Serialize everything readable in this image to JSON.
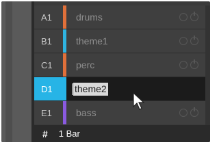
{
  "patterns": [
    {
      "slot": "A1",
      "name": "drums",
      "color": "#e0703a"
    },
    {
      "slot": "B1",
      "name": "theme1",
      "color": "#2fb3e0"
    },
    {
      "slot": "C1",
      "name": "perc",
      "color": "#e0703a"
    },
    {
      "slot": "D1",
      "name": "",
      "color": "#27b4e6",
      "selected": true,
      "edit_value": "theme2"
    },
    {
      "slot": "E1",
      "name": "bass",
      "color": "#8a5ae0"
    }
  ],
  "footer": {
    "symbol": "#",
    "length": "1 Bar"
  },
  "colors": {
    "selected_slot": "#27b4e6",
    "row_bg": "#3f3f3f",
    "edit_bg": "#1b1b1b"
  }
}
